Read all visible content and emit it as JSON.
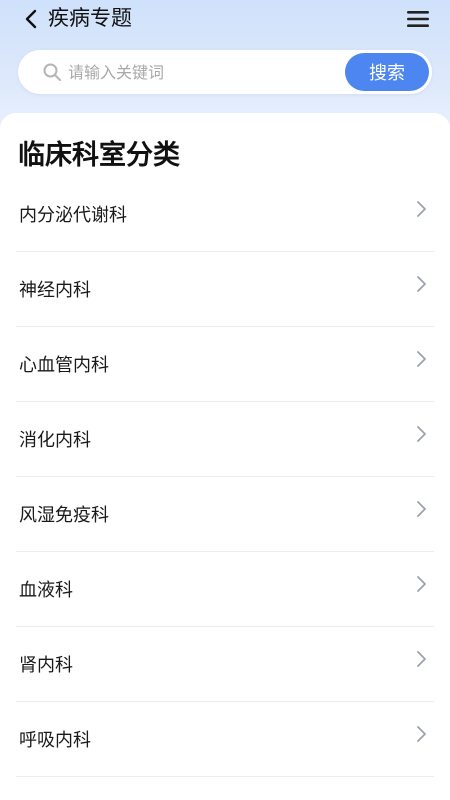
{
  "header": {
    "title": "疾病专题",
    "back_icon": "chevron-left-icon",
    "menu_icon": "hamburger-menu-icon"
  },
  "search": {
    "placeholder": "请输入关键词",
    "value": "",
    "button_label": "搜索",
    "accent_color": "#4d86f0"
  },
  "section": {
    "title": "临床科室分类",
    "items": [
      {
        "label": "内分泌代谢科"
      },
      {
        "label": "神经内科"
      },
      {
        "label": "心血管内科"
      },
      {
        "label": "消化内科"
      },
      {
        "label": "风湿免疫科"
      },
      {
        "label": "血液科"
      },
      {
        "label": "肾内科"
      },
      {
        "label": "呼吸内科"
      }
    ]
  }
}
